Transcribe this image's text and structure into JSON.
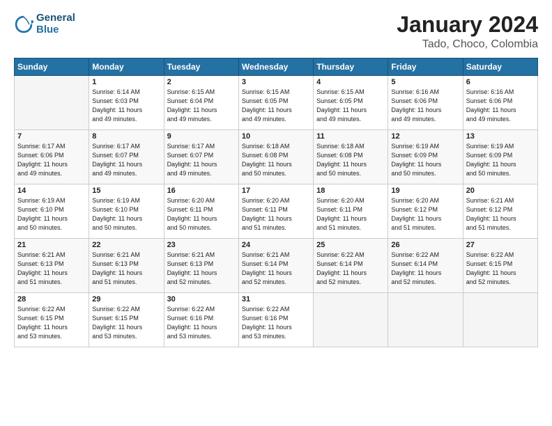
{
  "logo": {
    "line1": "General",
    "line2": "Blue"
  },
  "title": "January 2024",
  "location": "Tado, Choco, Colombia",
  "days_of_week": [
    "Sunday",
    "Monday",
    "Tuesday",
    "Wednesday",
    "Thursday",
    "Friday",
    "Saturday"
  ],
  "weeks": [
    [
      {
        "day": "",
        "text": ""
      },
      {
        "day": "1",
        "text": "Sunrise: 6:14 AM\nSunset: 6:03 PM\nDaylight: 11 hours\nand 49 minutes."
      },
      {
        "day": "2",
        "text": "Sunrise: 6:15 AM\nSunset: 6:04 PM\nDaylight: 11 hours\nand 49 minutes."
      },
      {
        "day": "3",
        "text": "Sunrise: 6:15 AM\nSunset: 6:05 PM\nDaylight: 11 hours\nand 49 minutes."
      },
      {
        "day": "4",
        "text": "Sunrise: 6:15 AM\nSunset: 6:05 PM\nDaylight: 11 hours\nand 49 minutes."
      },
      {
        "day": "5",
        "text": "Sunrise: 6:16 AM\nSunset: 6:06 PM\nDaylight: 11 hours\nand 49 minutes."
      },
      {
        "day": "6",
        "text": "Sunrise: 6:16 AM\nSunset: 6:06 PM\nDaylight: 11 hours\nand 49 minutes."
      }
    ],
    [
      {
        "day": "7",
        "text": "Sunrise: 6:17 AM\nSunset: 6:06 PM\nDaylight: 11 hours\nand 49 minutes."
      },
      {
        "day": "8",
        "text": "Sunrise: 6:17 AM\nSunset: 6:07 PM\nDaylight: 11 hours\nand 49 minutes."
      },
      {
        "day": "9",
        "text": "Sunrise: 6:17 AM\nSunset: 6:07 PM\nDaylight: 11 hours\nand 49 minutes."
      },
      {
        "day": "10",
        "text": "Sunrise: 6:18 AM\nSunset: 6:08 PM\nDaylight: 11 hours\nand 50 minutes."
      },
      {
        "day": "11",
        "text": "Sunrise: 6:18 AM\nSunset: 6:08 PM\nDaylight: 11 hours\nand 50 minutes."
      },
      {
        "day": "12",
        "text": "Sunrise: 6:19 AM\nSunset: 6:09 PM\nDaylight: 11 hours\nand 50 minutes."
      },
      {
        "day": "13",
        "text": "Sunrise: 6:19 AM\nSunset: 6:09 PM\nDaylight: 11 hours\nand 50 minutes."
      }
    ],
    [
      {
        "day": "14",
        "text": "Sunrise: 6:19 AM\nSunset: 6:10 PM\nDaylight: 11 hours\nand 50 minutes."
      },
      {
        "day": "15",
        "text": "Sunrise: 6:19 AM\nSunset: 6:10 PM\nDaylight: 11 hours\nand 50 minutes."
      },
      {
        "day": "16",
        "text": "Sunrise: 6:20 AM\nSunset: 6:11 PM\nDaylight: 11 hours\nand 50 minutes."
      },
      {
        "day": "17",
        "text": "Sunrise: 6:20 AM\nSunset: 6:11 PM\nDaylight: 11 hours\nand 51 minutes."
      },
      {
        "day": "18",
        "text": "Sunrise: 6:20 AM\nSunset: 6:11 PM\nDaylight: 11 hours\nand 51 minutes."
      },
      {
        "day": "19",
        "text": "Sunrise: 6:20 AM\nSunset: 6:12 PM\nDaylight: 11 hours\nand 51 minutes."
      },
      {
        "day": "20",
        "text": "Sunrise: 6:21 AM\nSunset: 6:12 PM\nDaylight: 11 hours\nand 51 minutes."
      }
    ],
    [
      {
        "day": "21",
        "text": "Sunrise: 6:21 AM\nSunset: 6:13 PM\nDaylight: 11 hours\nand 51 minutes."
      },
      {
        "day": "22",
        "text": "Sunrise: 6:21 AM\nSunset: 6:13 PM\nDaylight: 11 hours\nand 51 minutes."
      },
      {
        "day": "23",
        "text": "Sunrise: 6:21 AM\nSunset: 6:13 PM\nDaylight: 11 hours\nand 52 minutes."
      },
      {
        "day": "24",
        "text": "Sunrise: 6:21 AM\nSunset: 6:14 PM\nDaylight: 11 hours\nand 52 minutes."
      },
      {
        "day": "25",
        "text": "Sunrise: 6:22 AM\nSunset: 6:14 PM\nDaylight: 11 hours\nand 52 minutes."
      },
      {
        "day": "26",
        "text": "Sunrise: 6:22 AM\nSunset: 6:14 PM\nDaylight: 11 hours\nand 52 minutes."
      },
      {
        "day": "27",
        "text": "Sunrise: 6:22 AM\nSunset: 6:15 PM\nDaylight: 11 hours\nand 52 minutes."
      }
    ],
    [
      {
        "day": "28",
        "text": "Sunrise: 6:22 AM\nSunset: 6:15 PM\nDaylight: 11 hours\nand 53 minutes."
      },
      {
        "day": "29",
        "text": "Sunrise: 6:22 AM\nSunset: 6:15 PM\nDaylight: 11 hours\nand 53 minutes."
      },
      {
        "day": "30",
        "text": "Sunrise: 6:22 AM\nSunset: 6:16 PM\nDaylight: 11 hours\nand 53 minutes."
      },
      {
        "day": "31",
        "text": "Sunrise: 6:22 AM\nSunset: 6:16 PM\nDaylight: 11 hours\nand 53 minutes."
      },
      {
        "day": "",
        "text": ""
      },
      {
        "day": "",
        "text": ""
      },
      {
        "day": "",
        "text": ""
      }
    ]
  ]
}
